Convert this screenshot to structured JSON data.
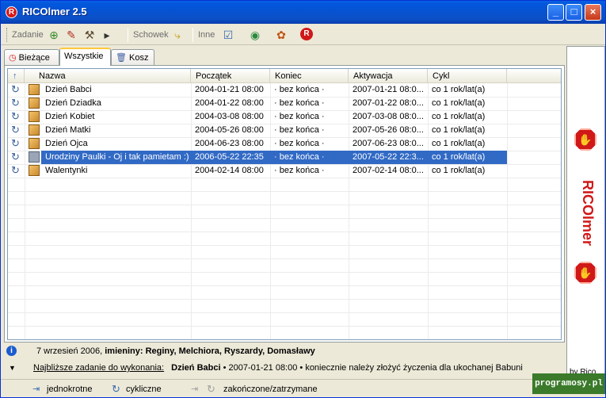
{
  "window": {
    "title": "RICOlmer 2.5",
    "icon_text": "R"
  },
  "toolbar": {
    "zadanie_label": "Zadanie",
    "schowek_label": "Schowek",
    "inne_label": "Inne"
  },
  "tabs": [
    {
      "label": "Bieżące"
    },
    {
      "label": "Wszystkie"
    },
    {
      "label": "Kosz"
    }
  ],
  "table": {
    "columns": [
      "Nazwa",
      "Początek",
      "Koniec",
      "Aktywacja",
      "Cykl"
    ],
    "rows": [
      {
        "name": "Dzień Babci",
        "start": "2004-01-21 08:00",
        "end": "· bez końca ·",
        "activation": "2007-01-21 08:0...",
        "cycle": "co 1 rok/lat(a)"
      },
      {
        "name": "Dzień Dziadka",
        "start": "2004-01-22 08:00",
        "end": "· bez końca ·",
        "activation": "2007-01-22 08:0...",
        "cycle": "co 1 rok/lat(a)"
      },
      {
        "name": "Dzień Kobiet",
        "start": "2004-03-08 08:00",
        "end": "· bez końca ·",
        "activation": "2007-03-08 08:0...",
        "cycle": "co 1 rok/lat(a)"
      },
      {
        "name": "Dzień Matki",
        "start": "2004-05-26 08:00",
        "end": "· bez końca ·",
        "activation": "2007-05-26 08:0...",
        "cycle": "co 1 rok/lat(a)"
      },
      {
        "name": "Dzień Ojca",
        "start": "2004-06-23 08:00",
        "end": "· bez końca ·",
        "activation": "2007-06-23 08:0...",
        "cycle": "co 1 rok/lat(a)"
      },
      {
        "name": "Urodziny Paulki - Oj i tak pamietam :)",
        "start": "2006-05-22 22:35",
        "end": "· bez końca ·",
        "activation": "2007-05-22 22:3...",
        "cycle": "co 1 rok/lat(a)"
      },
      {
        "name": "Walentynki",
        "start": "2004-02-14 08:00",
        "end": "· bez końca ·",
        "activation": "2007-02-14 08:0...",
        "cycle": "co 1 rok/lat(a)"
      }
    ],
    "selected_index": 5
  },
  "status": {
    "date": "7 wrzesień 2006,",
    "names_label": "imieniny:",
    "names": "Reginy, Melchiora, Ryszardy, Domasławy",
    "next_label": "Najbliższe zadanie do wykonania:",
    "next_task": "Dzień Babci",
    "next_detail": "• 2007-01-21 08:00 • koniecznie należy złożyć życzenia dla ukochanej Babuni"
  },
  "legend": {
    "one_time": "jednokrotne",
    "cyclic": "cykliczne",
    "finished": "zakończone/zatrzymane"
  },
  "sidebar": {
    "brand": "RICOlmer",
    "by": "by Rico"
  },
  "watermark": "programosy.pl",
  "colors": {
    "selection": "#316ac5",
    "brand_red": "#d01818",
    "titlebar": "#0b50c7"
  }
}
